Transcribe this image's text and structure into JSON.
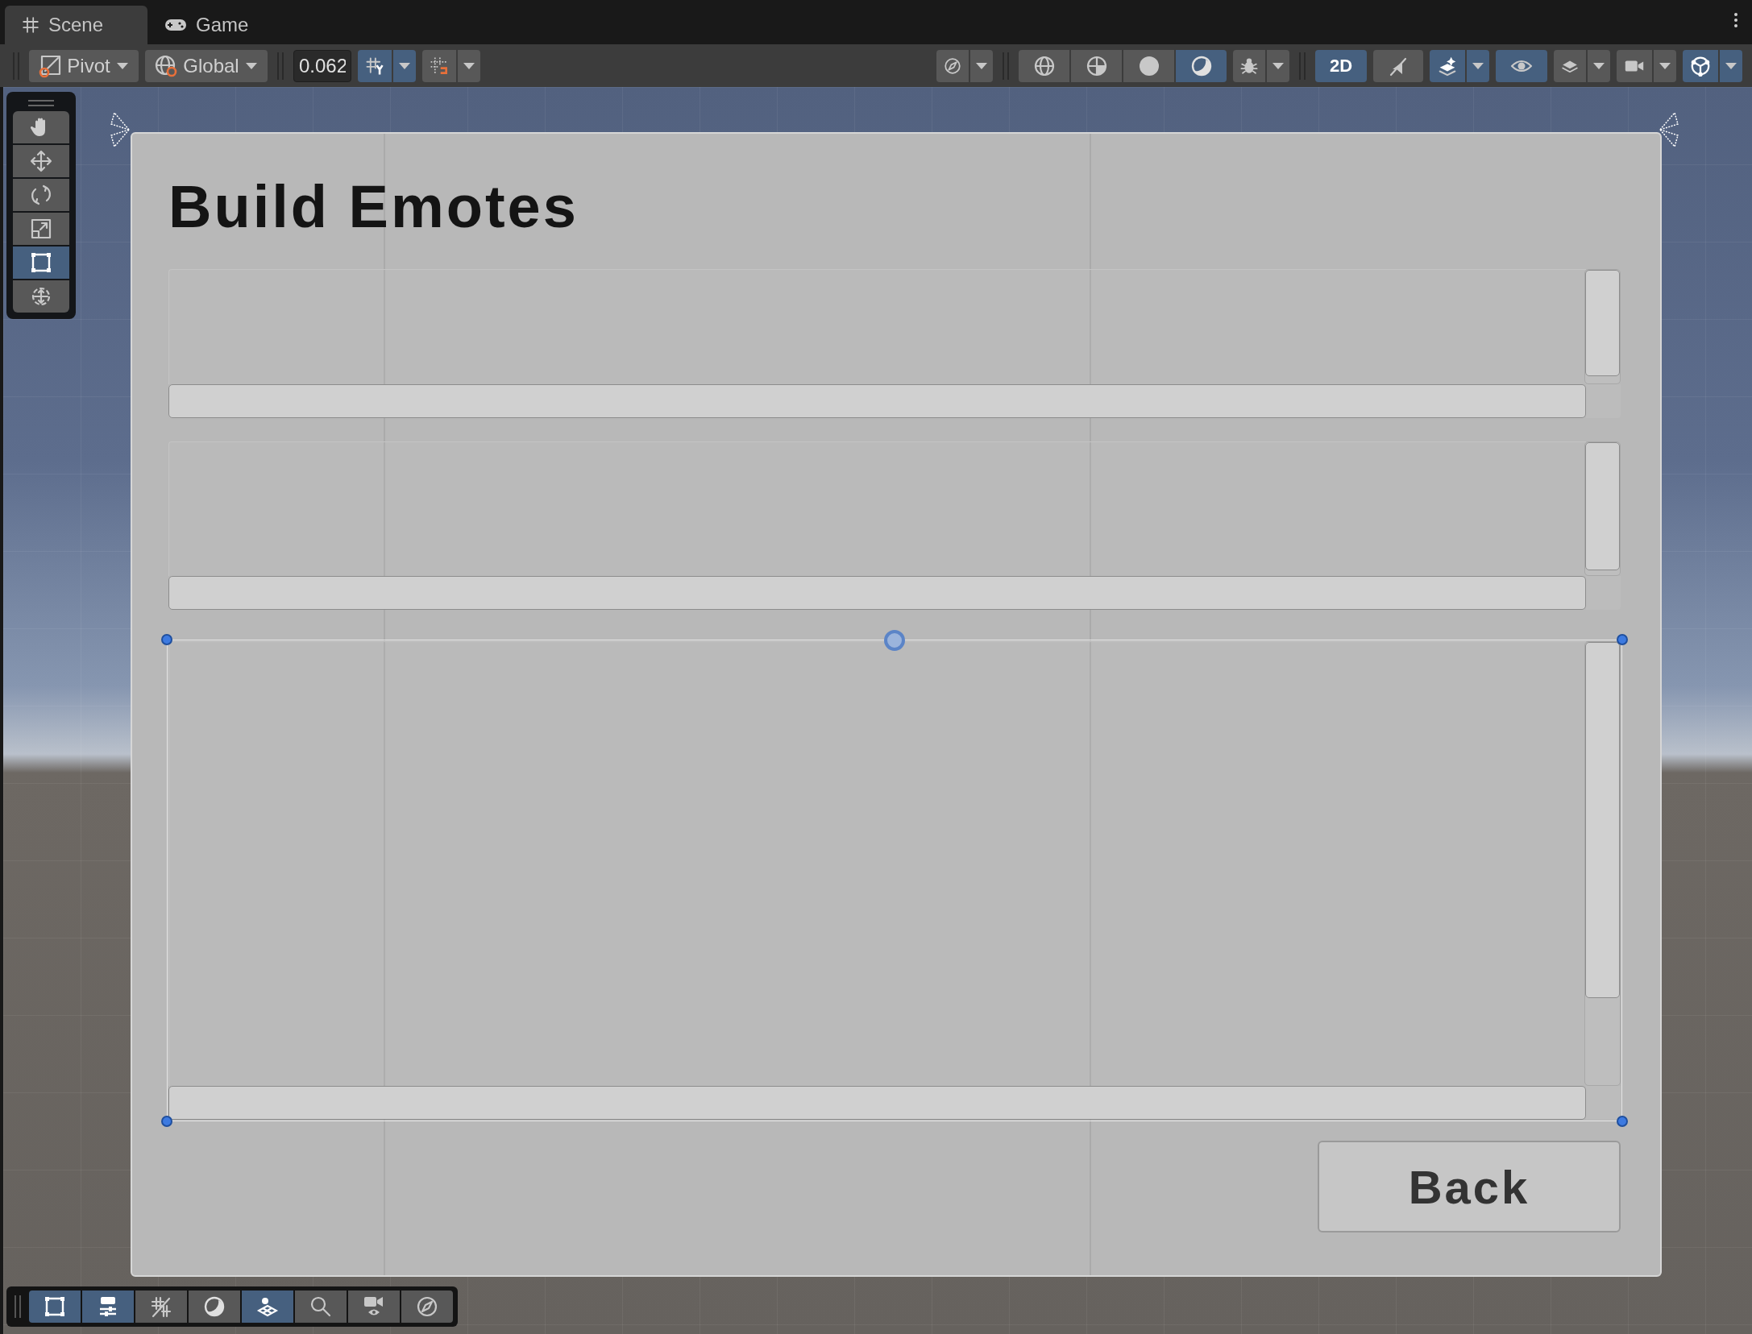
{
  "tabs": [
    {
      "label": "Scene",
      "selected": true
    },
    {
      "label": "Game",
      "selected": false
    }
  ],
  "toolbar": {
    "pivot": "Pivot",
    "space": "Global",
    "snap_value": "0.062",
    "2d_label": "2D",
    "left_toggles": [
      {
        "on": true
      },
      {
        "on": false
      }
    ],
    "right_toggles": [
      {
        "on": false
      },
      {
        "on": false
      },
      {
        "on": false
      },
      {
        "on": false
      },
      {
        "on": true
      },
      {
        "on": false
      },
      {
        "on": true
      },
      {
        "on": false
      },
      {
        "on": true
      },
      {
        "on": true
      },
      {
        "on": false
      },
      {
        "on": false
      },
      {
        "on": true
      }
    ]
  },
  "tools": [
    {
      "selected": false
    },
    {
      "selected": false
    },
    {
      "selected": false
    },
    {
      "selected": false
    },
    {
      "selected": true
    },
    {
      "selected": false
    }
  ],
  "canvas": {
    "title": "Build Emotes",
    "scroll_views": [
      {
        "selected": false
      },
      {
        "selected": false
      },
      {
        "selected": true
      }
    ],
    "back_button": "Back"
  },
  "overlay_toggles": [
    {
      "on": true
    },
    {
      "on": true
    },
    {
      "on": false
    },
    {
      "on": false
    },
    {
      "on": true
    },
    {
      "on": false
    },
    {
      "on": false
    },
    {
      "on": false
    }
  ]
}
